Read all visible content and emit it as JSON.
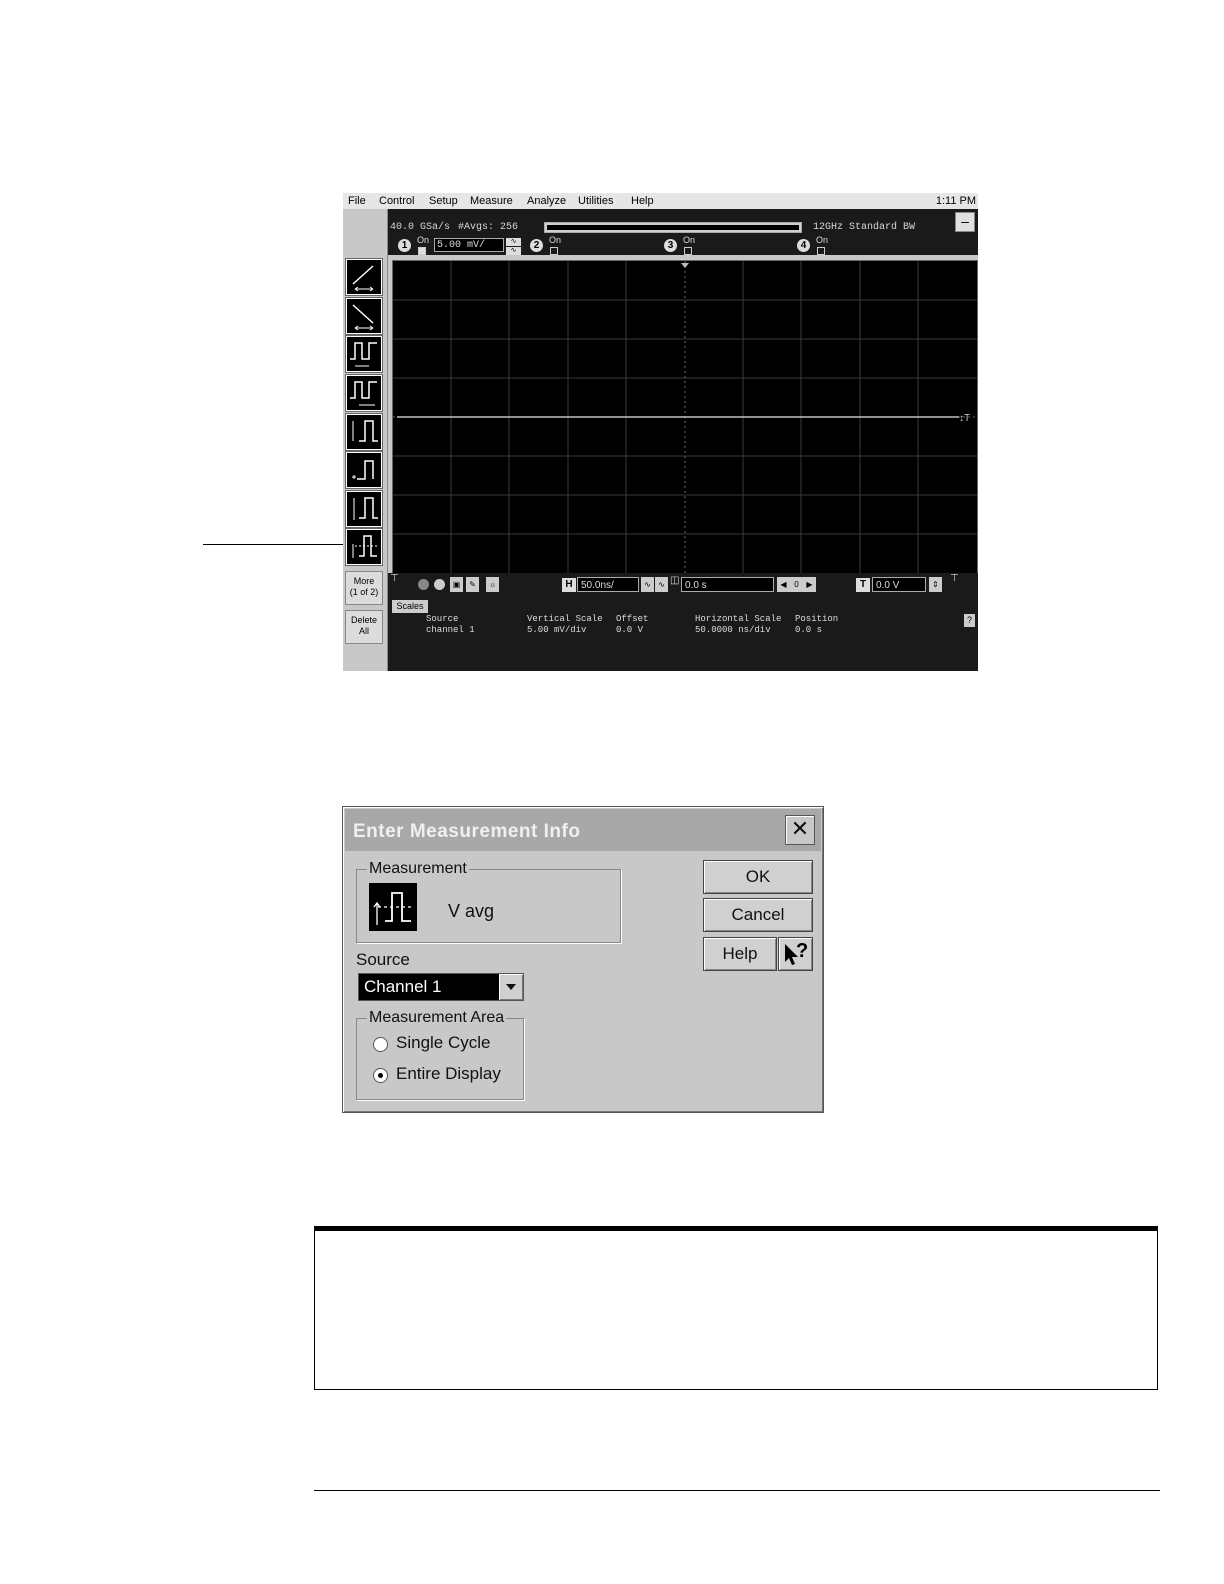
{
  "scope": {
    "menu": [
      "File",
      "Control",
      "Setup",
      "Measure",
      "Analyze",
      "Utilities",
      "Help"
    ],
    "clock": "1:11 PM",
    "status": {
      "sample_rate": "40.0 GSa/s",
      "avgs": "#Avgs: 256",
      "bandwidth": "12GHz Standard BW",
      "minimize": "–"
    },
    "channels": [
      {
        "num": "1",
        "on_label": "On",
        "scale": "5.00 mV/"
      },
      {
        "num": "2",
        "on_label": "On"
      },
      {
        "num": "3",
        "on_label": "On"
      },
      {
        "num": "4",
        "on_label": "On"
      }
    ],
    "side_buttons": {
      "more": "More",
      "more_page": "(1 of 2)",
      "delete": "Delete",
      "delete_all": "All"
    },
    "controls": {
      "h_icon": "H",
      "h_scale": "50.0ns/",
      "delay": "0.0 s",
      "delay_zero": "0",
      "t_icon": "T",
      "trigger": "0.0 V"
    },
    "scales": {
      "tab": "Scales",
      "headers": [
        "Source",
        "Vertical Scale",
        "Offset",
        "Horizontal Scale",
        "Position"
      ],
      "values": [
        "channel 1",
        "5.00 mV/div",
        "0.0 V",
        "50.0000 ns/div",
        "0.0 s"
      ],
      "help": "?"
    }
  },
  "dialog": {
    "title": "Enter Measurement Info",
    "close": "✕",
    "measurement_label": "Measurement",
    "measurement_value": "V avg",
    "source_label": "Source",
    "source_value": "Channel 1",
    "area_label": "Measurement Area",
    "options": [
      "Single Cycle",
      "Entire Display"
    ],
    "selected_option": "Entire Display",
    "ok": "OK",
    "cancel": "Cancel",
    "help": "Help",
    "whats_this": "?"
  }
}
